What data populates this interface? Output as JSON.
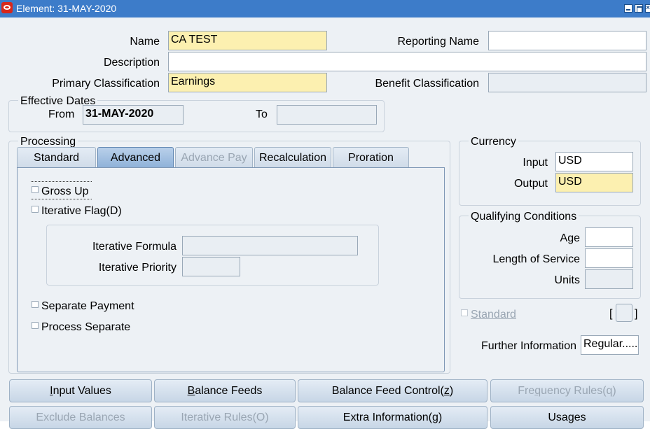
{
  "window": {
    "title": "Element: 31-MAY-2020"
  },
  "form": {
    "name_label": "Name",
    "name_value": "CA TEST",
    "reporting_label": "Reporting Name",
    "reporting_value": "",
    "description_label": "Description",
    "description_value": "",
    "primary_label": "Primary Classification",
    "primary_value": "Earnings",
    "benefit_label": "Benefit Classification",
    "benefit_value": ""
  },
  "effective_dates": {
    "title": "Effective Dates",
    "from_label": "From",
    "from_value": "31-MAY-2020",
    "to_label": "To",
    "to_value": ""
  },
  "processing": {
    "title": "Processing",
    "tabs": [
      {
        "label": "Standard"
      },
      {
        "label": "Advanced"
      },
      {
        "label": "Advance Pay"
      },
      {
        "label": "Recalculation"
      },
      {
        "label": "Proration"
      }
    ],
    "gross_up": "Gross Up",
    "iterative_flag": "Iterative Flag(D)",
    "iterative_formula_label": "Iterative Formula",
    "iterative_formula_value": "",
    "iterative_priority_label": "Iterative Priority",
    "iterative_priority_value": "",
    "separate_payment": "Separate Payment",
    "process_separate": "Process Separate"
  },
  "currency": {
    "title": "Currency",
    "input_label": "Input",
    "input_value": "USD",
    "output_label": "Output",
    "output_value": "USD"
  },
  "qualifying": {
    "title": "Qualifying Conditions",
    "age_label": "Age",
    "age_value": "",
    "los_label": "Length of Service",
    "los_value": "",
    "units_label": "Units",
    "units_value": ""
  },
  "standard": {
    "label": "Standard",
    "bracket_open": "[",
    "bracket_close": "]"
  },
  "further": {
    "label": "Further Information",
    "value": "Regular....."
  },
  "buttons": {
    "input_values": {
      "pre": "",
      "key": "I",
      "post": "nput Values"
    },
    "balance_feeds": {
      "pre": "",
      "key": "B",
      "post": "alance Feeds"
    },
    "balance_feed_control": {
      "pre": "Balance Feed Control(",
      "key": "z",
      "post": ")"
    },
    "frequency_rules": {
      "pre": "Fre",
      "key": "q",
      "post": "uency Rules(q)"
    },
    "exclude_balances": {
      "pre": "",
      "key": "",
      "post": "Exclude Balances"
    },
    "iterative_rules": {
      "pre": "",
      "key": "",
      "post": "Iterative Rules(O)"
    },
    "extra_information": {
      "pre": "",
      "key": "",
      "post": "Extra Information(g)"
    },
    "usages": {
      "pre": "",
      "key": "",
      "post": "Usages"
    }
  }
}
